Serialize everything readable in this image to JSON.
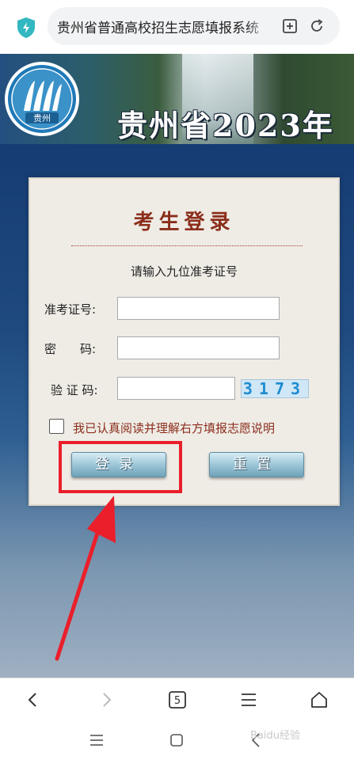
{
  "browser": {
    "url_text": "贵州省普通高校招生志愿填报系统",
    "tab_count": "5"
  },
  "banner": {
    "logo_text": "贵州",
    "title": "贵州省2023年"
  },
  "login": {
    "title": "考生登录",
    "hint": "请输入九位准考证号",
    "exam_id_label": "准考证号:",
    "exam_id_value": "",
    "password_label": "密　　码:",
    "password_value": "",
    "captcha_label": "验 证 码:",
    "captcha_value": "",
    "captcha_code": "3173",
    "agree_text": "我已认真阅读并理解右方填报志愿说明",
    "login_button": "登录",
    "reset_button": "重置"
  },
  "watermark": "Baidu经验",
  "colors": {
    "title_red": "#8b2e1c",
    "highlight_red": "#ea1f2b",
    "page_blue": "#163d73"
  }
}
